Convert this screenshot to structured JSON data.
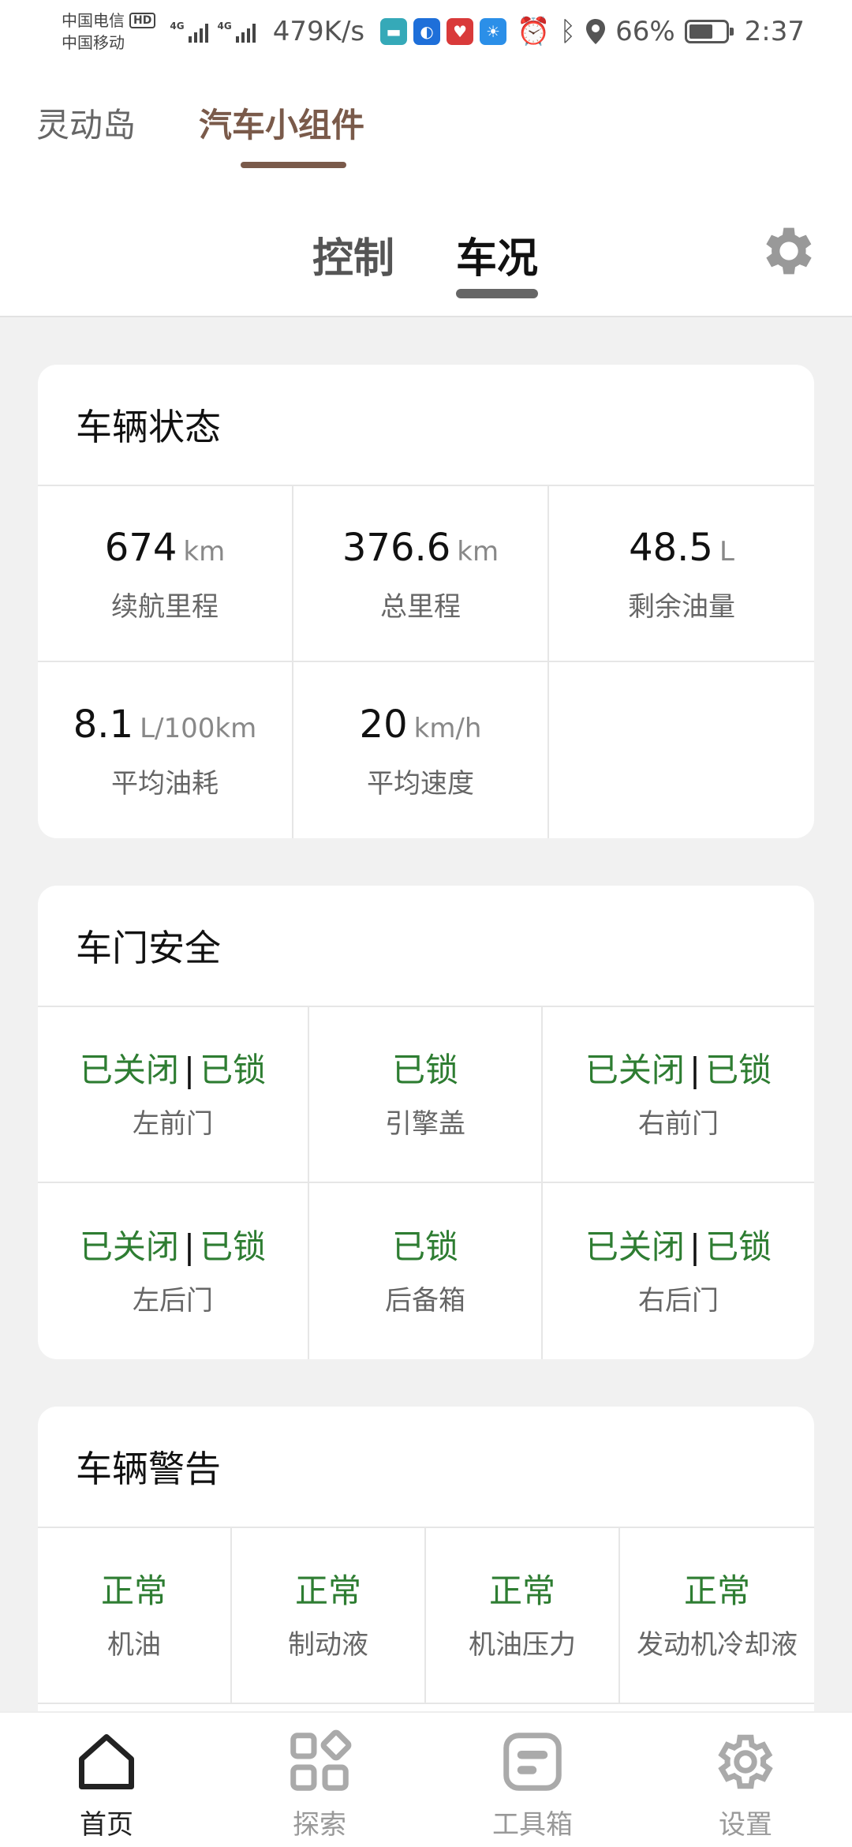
{
  "status_bar": {
    "carrier1": "中国电信",
    "carrier2": "中国移动",
    "hd": "HD",
    "net1": "4G",
    "net2": "4G",
    "speed": "479K/s",
    "battery_percent": "66%",
    "battery_level": 0.66,
    "time": "2:37"
  },
  "top_tabs": [
    {
      "label": "灵动岛",
      "active": false
    },
    {
      "label": "汽车小组件",
      "active": true
    }
  ],
  "sub_tabs": [
    {
      "label": "控制",
      "active": false
    },
    {
      "label": "车况",
      "active": true
    }
  ],
  "vehicle_status": {
    "title": "车辆状态",
    "items": [
      {
        "value": "674",
        "unit": "km",
        "label": "续航里程"
      },
      {
        "value": "376.6",
        "unit": "km",
        "label": "总里程"
      },
      {
        "value": "48.5",
        "unit": "L",
        "label": "剩余油量"
      },
      {
        "value": "8.1",
        "unit": "L/100km",
        "label": "平均油耗"
      },
      {
        "value": "20",
        "unit": "km/h",
        "label": "平均速度"
      }
    ]
  },
  "door_security": {
    "title": "车门安全",
    "items": [
      {
        "closed": "已关闭",
        "locked": "已锁",
        "label": "左前门"
      },
      {
        "closed": "",
        "locked": "已锁",
        "label": "引擎盖"
      },
      {
        "closed": "已关闭",
        "locked": "已锁",
        "label": "右前门"
      },
      {
        "closed": "已关闭",
        "locked": "已锁",
        "label": "左后门"
      },
      {
        "closed": "",
        "locked": "已锁",
        "label": "后备箱"
      },
      {
        "closed": "已关闭",
        "locked": "已锁",
        "label": "右后门"
      }
    ],
    "separator": "|"
  },
  "vehicle_warnings": {
    "title": "车辆警告",
    "items": [
      {
        "status": "正常",
        "label": "机油"
      },
      {
        "status": "正常",
        "label": "制动液"
      },
      {
        "status": "正常",
        "label": "机油压力"
      },
      {
        "status": "正常",
        "label": "发动机冷却液"
      }
    ]
  },
  "bottom_nav": [
    {
      "label": "首页",
      "icon": "home-icon",
      "active": true
    },
    {
      "label": "探索",
      "icon": "explore-grid-icon",
      "active": false
    },
    {
      "label": "工具箱",
      "icon": "toolbox-icon",
      "active": false
    },
    {
      "label": "设置",
      "icon": "gear-icon",
      "active": false
    }
  ],
  "colors": {
    "accent_brown": "#7a5a4a",
    "status_green": "#2e7d32"
  }
}
